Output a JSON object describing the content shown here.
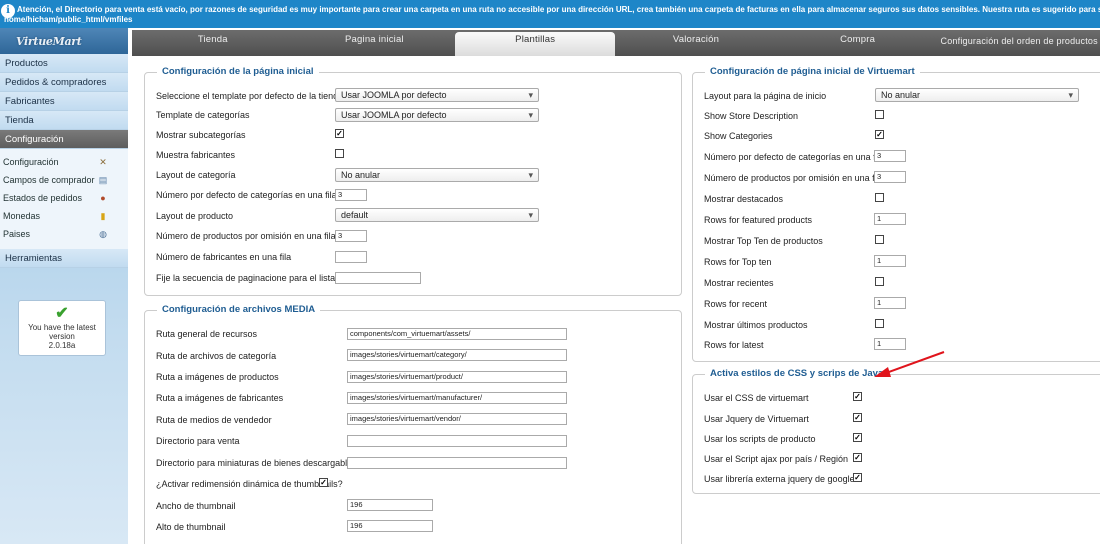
{
  "notice": {
    "line1": "Atención, el Directorio para venta está vacío, por razones de seguridad es muy importante para crear una carpeta en una ruta no accesible por una dirección URL, crea también una carpeta de facturas en ella para almacenar seguros sus datos sensibles. Nuestra ruta es sugerido para su sistema:",
    "line2": "home/hicham/public_html/vmfiles"
  },
  "sidebar": {
    "logo": "VirtueMart",
    "items": [
      "Productos",
      "Pedidos & compradores",
      "Fabricantes",
      "Tienda",
      "Configuración"
    ],
    "sub_items": [
      {
        "label": "Configuración",
        "icon": "wrench-icon"
      },
      {
        "label": "Campos de comprador",
        "icon": "form-icon"
      },
      {
        "label": "Estados de pedidos",
        "icon": "status-icon"
      },
      {
        "label": "Monedas",
        "icon": "coins-icon"
      },
      {
        "label": "Paises",
        "icon": "globe-icon"
      }
    ],
    "tools": "Herramientas",
    "version": {
      "line1": "You have the latest",
      "line2": "version",
      "line3": "2.0.18a"
    }
  },
  "tabs": [
    "Tienda",
    "Pagina inicial",
    "Plantillas",
    "Valoración",
    "Compra",
    "Configuración del orden de productos"
  ],
  "home": {
    "legend": "Configuración de la página inicial",
    "template_label": "Seleccione el template por defecto de la tienda",
    "template_value": "Usar JOOMLA por defecto",
    "cat_template_label": "Template de categorías",
    "cat_template_value": "Usar JOOMLA por defecto",
    "show_subcats_label": "Mostrar subcategorías",
    "show_manuf_label": "Muestra fabricantes",
    "cat_layout_label": "Layout de categoría",
    "cat_layout_value": "No anular",
    "cats_per_row_label": "Número por defecto de categorías en una fila",
    "cats_per_row_value": "3",
    "prod_layout_label": "Layout de producto",
    "prod_layout_value": "default",
    "prods_per_row_label": "Número de productos por omisión en una fila",
    "prods_per_row_value": "3",
    "manuf_per_row_label": "Número de fabricantes en una fila",
    "pagination_label": "Fije la secuencia de paginacione para el listado"
  },
  "media": {
    "legend": "Configuración de archivos MEDIA",
    "rows": [
      {
        "label": "Ruta general de recursos",
        "value": "components/com_virtuemart/assets/"
      },
      {
        "label": "Ruta de archivos de categoría",
        "value": "images/stories/virtuemart/category/"
      },
      {
        "label": "Ruta a imágenes de productos",
        "value": "images/stories/virtuemart/product/"
      },
      {
        "label": "Ruta a imágenes de fabricantes",
        "value": "images/stories/virtuemart/manufacturer/"
      },
      {
        "label": "Ruta de medios de vendedor",
        "value": "images/stories/virtuemart/vendor/"
      },
      {
        "label": "Directorio para venta",
        "value": ""
      },
      {
        "label": "Directorio para miniaturas de bienes descargables",
        "value": ""
      }
    ],
    "resize_label": "¿Activar redimensión dinámica de thumbnails?",
    "thumb_w_label": "Ancho de thumbnail",
    "thumb_w_value": "196",
    "thumb_h_label": "Alto de thumbnail",
    "thumb_h_value": "196"
  },
  "vm_home": {
    "legend": "Configuración de página inicial de Virtuemart",
    "layout_label": "Layout para la página de inicio",
    "layout_value": "No anular",
    "store_desc_label": "Show Store Description",
    "show_cats_label": "Show Categories",
    "cats_row_label": "Número por defecto de categorías en una fila",
    "cats_row_value": "3",
    "prods_row_label": "Número de productos por omisión en una fila",
    "prods_row_value": "3",
    "featured_label": "Mostrar destacados",
    "rows_featured_label": "Rows for featured products",
    "rows_featured_value": "1",
    "topten_label": "Mostrar Top Ten de productos",
    "rows_topten_label": "Rows for Top ten",
    "rows_topten_value": "1",
    "recent_label": "Mostrar recientes",
    "rows_recent_label": "Rows for recent",
    "rows_recent_value": "1",
    "latest_label": "Mostrar últimos productos",
    "rows_latest_label": "Rows for latest",
    "rows_latest_value": "1"
  },
  "css_js": {
    "legend": "Activa estilos de CSS y scrips de Java",
    "rows": [
      "Usar el CSS de virtuemart",
      "Usar Jquery de Virtuemart",
      "Usar los scripts de producto",
      "Usar el Script ajax por país / Región",
      "Usar librería externa jquery de google"
    ]
  },
  "colors": {
    "notice": "#1e86c8",
    "legend": "#1f5d92",
    "arrow": "#e0141c"
  }
}
